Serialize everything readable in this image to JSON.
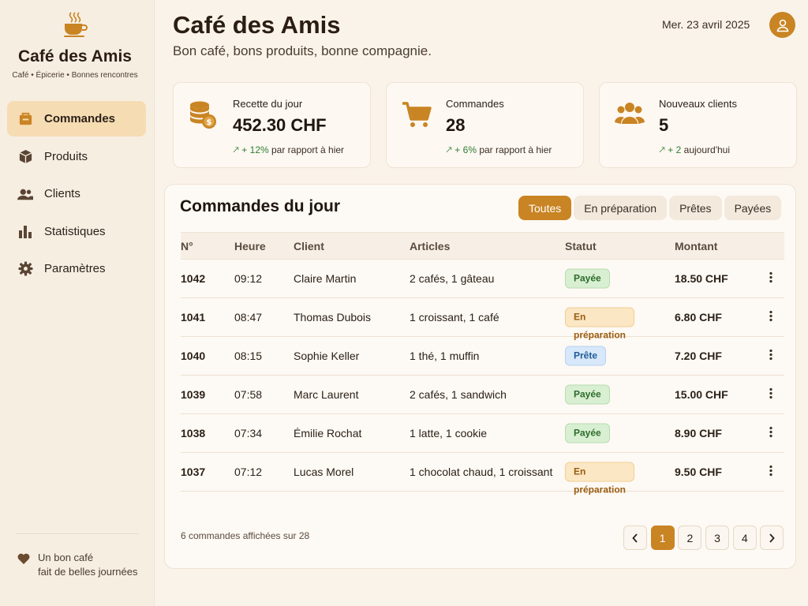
{
  "app": {
    "name": "Café des Amis",
    "tagline": "Café • Épicerie • Bonnes rencontres"
  },
  "sidebar": {
    "items": [
      {
        "label": "Commandes",
        "icon": "orders-icon",
        "active": true
      },
      {
        "label": "Produits",
        "icon": "box-icon",
        "active": false
      },
      {
        "label": "Clients",
        "icon": "users-icon",
        "active": false
      },
      {
        "label": "Statistiques",
        "icon": "bar-chart-icon",
        "active": false
      },
      {
        "label": "Paramètres",
        "icon": "gear-icon",
        "active": false
      }
    ],
    "footer": {
      "line1": "Un bon café",
      "line2": "fait de belles journées",
      "icon": "heart-icon"
    }
  },
  "header": {
    "title": "Café des Amis",
    "subtitle": "Bon café, bons produits, bonne compagnie.",
    "date": "Mer. 23 avril 2025",
    "avatar_icon": "user-icon"
  },
  "stats": [
    {
      "label": "Recette du jour",
      "value": "452.30 CHF",
      "trend_value": "+ 12%",
      "trend_text": "par rapport à hier",
      "icon": "coins-icon"
    },
    {
      "label": "Commandes",
      "value": "28",
      "trend_value": "+ 6%",
      "trend_text": "par rapport à hier",
      "icon": "cart-icon"
    },
    {
      "label": "Nouveaux clients",
      "value": "5",
      "trend_value": "+ 2",
      "trend_text": "aujourd'hui",
      "icon": "group-icon"
    }
  ],
  "orders": {
    "title": "Commandes du jour",
    "filters": [
      {
        "label": "Toutes",
        "active": true
      },
      {
        "label": "En préparation",
        "active": false
      },
      {
        "label": "Prêtes",
        "active": false
      },
      {
        "label": "Payées",
        "active": false
      }
    ],
    "columns": [
      "N°",
      "Heure",
      "Client",
      "Articles",
      "Statut",
      "Montant"
    ],
    "rows": [
      {
        "no": "1042",
        "time": "09:12",
        "client": "Claire Martin",
        "items": "2 cafés, 1 gâteau",
        "status": "Payée",
        "status_type": "paid",
        "amount": "18.50 CHF"
      },
      {
        "no": "1041",
        "time": "08:47",
        "client": "Thomas Dubois",
        "items": "1 croissant, 1 café",
        "status": "En préparation",
        "status_type": "prep",
        "amount": "6.80 CHF"
      },
      {
        "no": "1040",
        "time": "08:15",
        "client": "Sophie Keller",
        "items": "1 thé, 1 muffin",
        "status": "Prête",
        "status_type": "ready",
        "amount": "7.20 CHF"
      },
      {
        "no": "1039",
        "time": "07:58",
        "client": "Marc Laurent",
        "items": "2 cafés, 1 sandwich",
        "status": "Payée",
        "status_type": "paid",
        "amount": "15.00 CHF"
      },
      {
        "no": "1038",
        "time": "07:34",
        "client": "Émilie Rochat",
        "items": "1 latte, 1 cookie",
        "status": "Payée",
        "status_type": "paid",
        "amount": "8.90 CHF"
      },
      {
        "no": "1037",
        "time": "07:12",
        "client": "Lucas Morel",
        "items": "1 chocolat chaud, 1 croissant",
        "status": "En préparation",
        "status_type": "prep",
        "amount": "9.50 CHF"
      }
    ],
    "count_text": "6 commandes affichées sur 28",
    "pagination": {
      "pages": [
        "1",
        "2",
        "3",
        "4"
      ],
      "current": "1"
    }
  },
  "colors": {
    "accent": "#c98423",
    "active_nav": "#f6dcb3",
    "background": "#faf3ea",
    "trend_up": "#2f7d32"
  }
}
